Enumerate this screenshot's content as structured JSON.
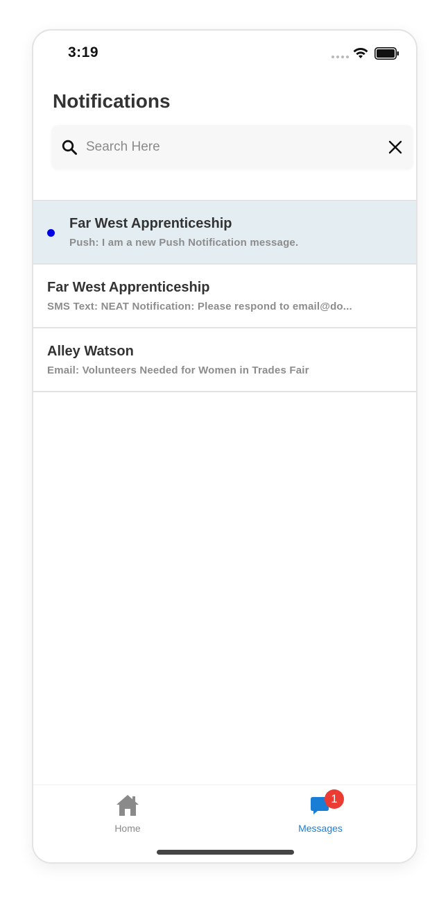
{
  "status_bar": {
    "time": "3:19",
    "signal_icon": "signal-dots-icon",
    "wifi_icon": "wifi-icon",
    "battery_icon": "battery-icon"
  },
  "header": {
    "title": "Notifications"
  },
  "search": {
    "placeholder": "Search Here",
    "value": "",
    "search_icon": "search-icon",
    "clear_icon": "close-icon"
  },
  "notifications": [
    {
      "title": "Far West Apprenticeship",
      "subtitle": "Push: I am a new Push Notification message.",
      "unread": true
    },
    {
      "title": "Far West Apprenticeship",
      "subtitle": "SMS Text: NEAT Notification: Please respond to email@do...",
      "unread": false
    },
    {
      "title": "Alley Watson",
      "subtitle": "Email: Volunteers Needed for Women in Trades Fair",
      "unread": false
    }
  ],
  "tab_bar": {
    "tabs": [
      {
        "label": "Home",
        "icon": "home-icon",
        "active": false
      },
      {
        "label": "Messages",
        "icon": "messages-icon",
        "active": true,
        "badge": "1"
      }
    ]
  },
  "colors": {
    "unread_background": "#e4eef2",
    "unread_dot": "#0000e6",
    "active_tab": "#1a7ed6",
    "inactive_tab": "#8a8a8a",
    "badge": "#ec3b33"
  }
}
